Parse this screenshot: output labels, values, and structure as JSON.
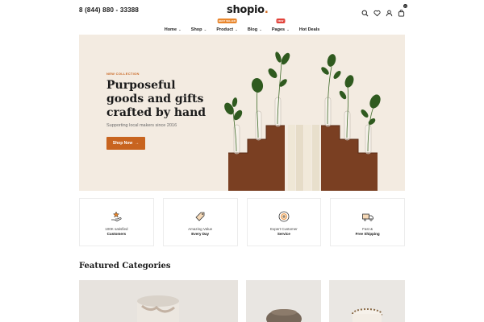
{
  "header": {
    "phone": "8 (844) 880 - 33388",
    "logo_text": "shopio",
    "logo_dot": ".",
    "icons": [
      "search-icon",
      "heart-icon",
      "user-icon",
      "cart-icon"
    ],
    "cart_count": "0"
  },
  "nav": {
    "items": [
      {
        "label": "Home",
        "chevron": "⌄",
        "badge": ""
      },
      {
        "label": "Shop",
        "chevron": "⌄",
        "badge": ""
      },
      {
        "label": "Product",
        "chevron": "⌄",
        "badge": "BEST SELLER"
      },
      {
        "label": "Blog",
        "chevron": "⌄",
        "badge": ""
      },
      {
        "label": "Pages",
        "chevron": "⌄",
        "badge": "NEW"
      },
      {
        "label": "Hot Deals",
        "chevron": "",
        "badge": ""
      }
    ]
  },
  "hero": {
    "eyebrow": "NEW COLLECTION",
    "title": "Purposeful goods and gifts crafted by hand",
    "subtitle": "Supporting local makers since 2016",
    "button_label": "Shop Now",
    "button_arrow": "→"
  },
  "features": [
    {
      "icon": "hand-star-icon",
      "line1": "100K satisfied",
      "line2": "Customers"
    },
    {
      "icon": "price-tag-icon",
      "line1": "Amazing Value",
      "line2": "Every Day"
    },
    {
      "icon": "support-badge-icon",
      "line1": "Expert Customer",
      "line2": "Service"
    },
    {
      "icon": "truck-icon",
      "line1": "Fast &",
      "line2": "Free Shipping"
    }
  ],
  "featured": {
    "title": "Featured Categories"
  },
  "colors": {
    "accent": "#c8641f",
    "hero_bg": "#f3ebe1",
    "wood": "#7a3f22"
  }
}
